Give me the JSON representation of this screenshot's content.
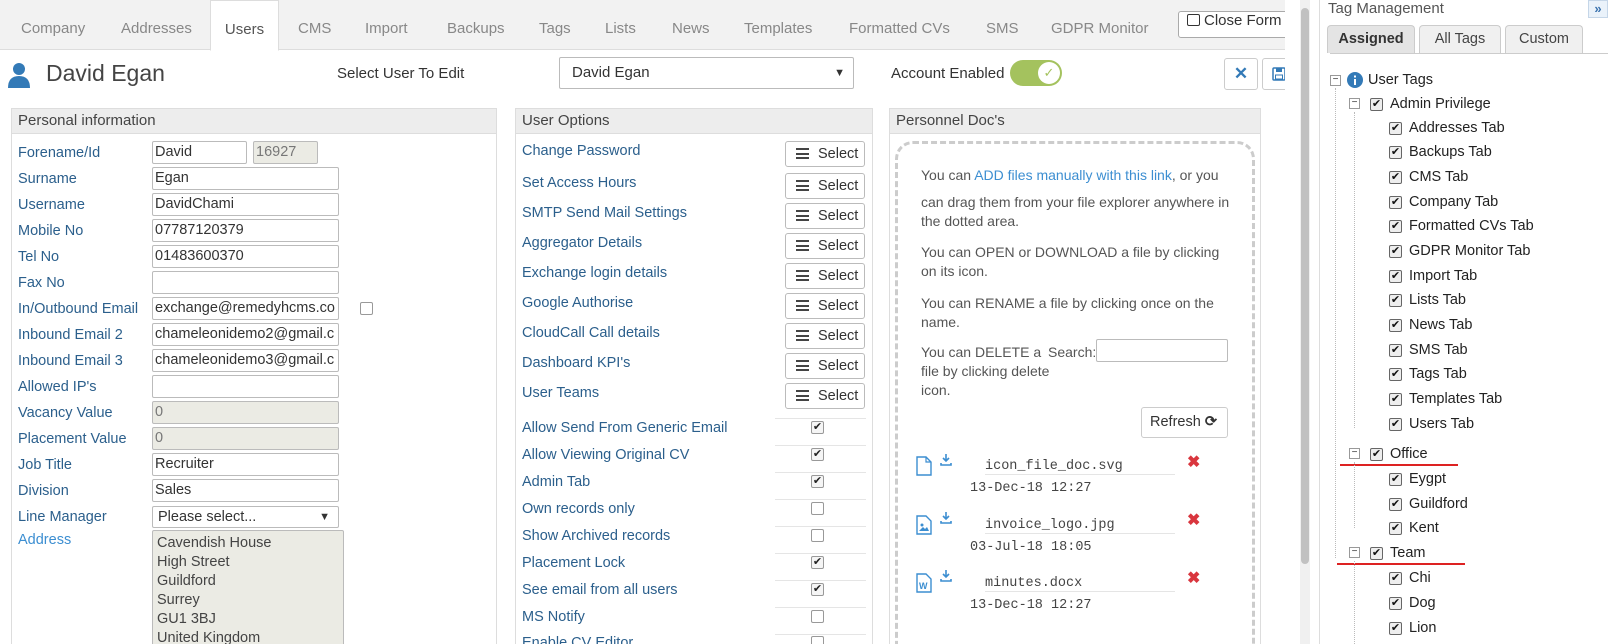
{
  "tabs": [
    "Company",
    "Addresses",
    "Users",
    "CMS",
    "Import",
    "Backups",
    "Tags",
    "Lists",
    "News",
    "Templates",
    "Formatted CVs",
    "SMS",
    "GDPR Monitor"
  ],
  "close_form": "Close Form",
  "user": {
    "name": "David Egan",
    "select_label": "Select User To Edit",
    "selected": "David Egan",
    "account_label": "Account Enabled"
  },
  "personal": {
    "title": "Personal information",
    "labels": [
      "Forename/Id",
      "Surname",
      "Username",
      "Mobile No",
      "Tel No",
      "Fax No",
      "In/Outbound Email",
      "Inbound Email 2",
      "Inbound Email 3",
      "Allowed IP's",
      "Vacancy Value",
      "Placement Value",
      "Job Title",
      "Division",
      "Line Manager",
      "Address"
    ],
    "forename": "David",
    "id": "16927",
    "values": [
      "Egan",
      "DavidChami",
      "07787120379",
      "01483600370",
      "",
      "exchange@remedyhcms.co",
      "chameleonidemo2@gmail.c",
      "chameleonidemo3@gmail.c",
      "",
      "0",
      "0",
      "Recruiter",
      "Sales"
    ],
    "line_manager": "Please select...",
    "address": [
      "Cavendish House",
      "High Street",
      "Guildford",
      "Surrey",
      "GU1 3BJ",
      "United Kingdom"
    ]
  },
  "options": {
    "title": "User Options",
    "select_label": "Select",
    "select_items": [
      "Change Password",
      "Set Access Hours",
      "SMTP Send Mail Settings",
      "Aggregator Details",
      "Exchange login details",
      "Google Authorise",
      "CloudCall Call details",
      "Dashboard KPI's",
      "User Teams"
    ],
    "check_items": [
      {
        "label": "Allow Send From Generic Email",
        "checked": true
      },
      {
        "label": "Allow Viewing Original CV",
        "checked": true
      },
      {
        "label": "Admin Tab",
        "checked": true
      },
      {
        "label": "Own records only",
        "checked": false
      },
      {
        "label": "Show Archived records",
        "checked": false
      },
      {
        "label": "Placement Lock",
        "checked": true
      },
      {
        "label": "See email from all users",
        "checked": true
      },
      {
        "label": "MS Notify",
        "checked": false
      },
      {
        "label": "Enable CV Editor",
        "checked": false
      }
    ]
  },
  "docs": {
    "title": "Personnel Doc's",
    "p1a": "You can ",
    "p1link": "ADD files manually with this link",
    "p1b": ", or you",
    "p1c": "can drag them from your file explorer anywhere in",
    "p1d": "the dotted area.",
    "p2a": "You can OPEN or DOWNLOAD a file by clicking",
    "p2b": "on its icon.",
    "p3a": "You can RENAME a file by clicking once on the",
    "p3b": "name.",
    "p4a": "You can DELETE a",
    "p4b": "file by clicking delete",
    "p4c": "icon.",
    "search_label": "Search:",
    "refresh": "Refresh",
    "files": [
      {
        "name": "icon_file_doc.svg",
        "date": "13-Dec-18 12:27"
      },
      {
        "name": "invoice_logo.jpg",
        "date": "03-Jul-18 18:05"
      },
      {
        "name": "minutes.docx",
        "date": "13-Dec-18 12:27"
      }
    ]
  },
  "tags": {
    "title": "Tag Management",
    "tabs": [
      "Assigned",
      "All Tags",
      "Custom"
    ],
    "root": "User Tags",
    "groups": [
      {
        "name": "Admin Privilege",
        "items": [
          "Addresses Tab",
          "Backups Tab",
          "CMS Tab",
          "Company Tab",
          "Formatted CVs Tab",
          "GDPR Monitor Tab",
          "Import Tab",
          "Lists Tab",
          "News Tab",
          "SMS Tab",
          "Tags Tab",
          "Templates Tab",
          "Users Tab"
        ]
      },
      {
        "name": "Office",
        "items": [
          "Eygpt",
          "Guildford",
          "Kent"
        ]
      },
      {
        "name": "Team",
        "items": [
          "Chi",
          "Dog",
          "Lion"
        ]
      }
    ]
  },
  "colors": {
    "accent": "#337ab7",
    "label": "#2b5f8c",
    "toggle": "#a4c25e",
    "delete": "#d9363e",
    "annotation": "#dd2222"
  }
}
